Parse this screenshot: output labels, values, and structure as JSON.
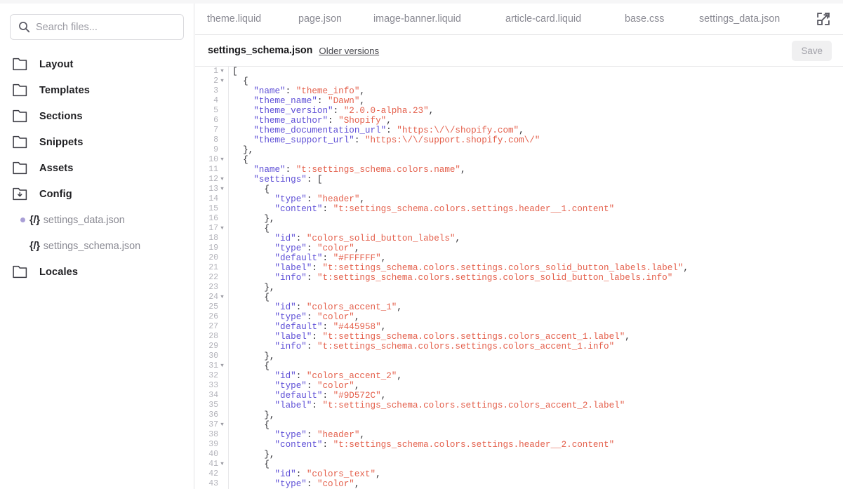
{
  "sidebar": {
    "search": {
      "placeholder": "Search files...",
      "value": "",
      "icon": "search-icon"
    },
    "items": [
      {
        "label": "Layout",
        "icon": "folder-icon",
        "type": "folder"
      },
      {
        "label": "Templates",
        "icon": "folder-icon",
        "type": "folder"
      },
      {
        "label": "Sections",
        "icon": "folder-icon",
        "type": "folder"
      },
      {
        "label": "Snippets",
        "icon": "folder-icon",
        "type": "folder"
      },
      {
        "label": "Assets",
        "icon": "folder-icon",
        "type": "folder"
      },
      {
        "label": "Config",
        "icon": "folder-open-icon",
        "type": "folder",
        "expanded": true
      },
      {
        "label": "settings_data.json",
        "icon": "json-file-icon",
        "type": "file",
        "modified": true,
        "brace": "{/}"
      },
      {
        "label": "settings_schema.json",
        "icon": "json-file-icon",
        "type": "file",
        "modified": false,
        "brace": "{/}"
      },
      {
        "label": "Locales",
        "icon": "folder-icon",
        "type": "folder"
      }
    ]
  },
  "tabs": [
    {
      "label": "theme.liquid"
    },
    {
      "label": "page.json"
    },
    {
      "label": "image-banner.liquid"
    },
    {
      "label": "article-card.liquid"
    },
    {
      "label": "base.css"
    },
    {
      "label": "settings_data.json"
    }
  ],
  "expand_icon": "expand-icon",
  "filebar": {
    "filename": "settings_schema.json",
    "older_versions_label": "Older versions",
    "save_label": "Save",
    "save_disabled": true
  },
  "colors": {
    "key": "#5d4ed6",
    "string": "#e4604c",
    "punctuation": "#2b2b30",
    "modified_dot": "#a99fd6",
    "border": "#e3e3e5",
    "save_bg": "#f0f0f1"
  },
  "editor": {
    "lines": [
      {
        "n": 1,
        "fold": true,
        "tokens": [
          [
            "p",
            "["
          ]
        ]
      },
      {
        "n": 2,
        "fold": true,
        "tokens": [
          [
            "p",
            "  {"
          ]
        ]
      },
      {
        "n": 3,
        "fold": false,
        "tokens": [
          [
            "k",
            "    \"name\""
          ],
          [
            "p",
            ": "
          ],
          [
            "s",
            "\"theme_info\""
          ],
          [
            "p",
            ","
          ]
        ]
      },
      {
        "n": 4,
        "fold": false,
        "tokens": [
          [
            "k",
            "    \"theme_name\""
          ],
          [
            "p",
            ": "
          ],
          [
            "s",
            "\"Dawn\""
          ],
          [
            "p",
            ","
          ]
        ]
      },
      {
        "n": 5,
        "fold": false,
        "tokens": [
          [
            "k",
            "    \"theme_version\""
          ],
          [
            "p",
            ": "
          ],
          [
            "s",
            "\"2.0.0-alpha.23\""
          ],
          [
            "p",
            ","
          ]
        ]
      },
      {
        "n": 6,
        "fold": false,
        "tokens": [
          [
            "k",
            "    \"theme_author\""
          ],
          [
            "p",
            ": "
          ],
          [
            "s",
            "\"Shopify\""
          ],
          [
            "p",
            ","
          ]
        ]
      },
      {
        "n": 7,
        "fold": false,
        "tokens": [
          [
            "k",
            "    \"theme_documentation_url\""
          ],
          [
            "p",
            ": "
          ],
          [
            "s",
            "\"https:\\/\\/shopify.com\""
          ],
          [
            "p",
            ","
          ]
        ]
      },
      {
        "n": 8,
        "fold": false,
        "tokens": [
          [
            "k",
            "    \"theme_support_url\""
          ],
          [
            "p",
            ": "
          ],
          [
            "s",
            "\"https:\\/\\/support.shopify.com\\/\""
          ]
        ]
      },
      {
        "n": 9,
        "fold": false,
        "tokens": [
          [
            "p",
            "  },"
          ]
        ]
      },
      {
        "n": 10,
        "fold": true,
        "tokens": [
          [
            "p",
            "  {"
          ]
        ]
      },
      {
        "n": 11,
        "fold": false,
        "tokens": [
          [
            "k",
            "    \"name\""
          ],
          [
            "p",
            ": "
          ],
          [
            "s",
            "\"t:settings_schema.colors.name\""
          ],
          [
            "p",
            ","
          ]
        ]
      },
      {
        "n": 12,
        "fold": true,
        "tokens": [
          [
            "k",
            "    \"settings\""
          ],
          [
            "p",
            ": ["
          ]
        ]
      },
      {
        "n": 13,
        "fold": true,
        "tokens": [
          [
            "p",
            "      {"
          ]
        ]
      },
      {
        "n": 14,
        "fold": false,
        "tokens": [
          [
            "k",
            "        \"type\""
          ],
          [
            "p",
            ": "
          ],
          [
            "s",
            "\"header\""
          ],
          [
            "p",
            ","
          ]
        ]
      },
      {
        "n": 15,
        "fold": false,
        "tokens": [
          [
            "k",
            "        \"content\""
          ],
          [
            "p",
            ": "
          ],
          [
            "s",
            "\"t:settings_schema.colors.settings.header__1.content\""
          ]
        ]
      },
      {
        "n": 16,
        "fold": false,
        "tokens": [
          [
            "p",
            "      },"
          ]
        ]
      },
      {
        "n": 17,
        "fold": true,
        "tokens": [
          [
            "p",
            "      {"
          ]
        ]
      },
      {
        "n": 18,
        "fold": false,
        "tokens": [
          [
            "k",
            "        \"id\""
          ],
          [
            "p",
            ": "
          ],
          [
            "s",
            "\"colors_solid_button_labels\""
          ],
          [
            "p",
            ","
          ]
        ]
      },
      {
        "n": 19,
        "fold": false,
        "tokens": [
          [
            "k",
            "        \"type\""
          ],
          [
            "p",
            ": "
          ],
          [
            "s",
            "\"color\""
          ],
          [
            "p",
            ","
          ]
        ]
      },
      {
        "n": 20,
        "fold": false,
        "tokens": [
          [
            "k",
            "        \"default\""
          ],
          [
            "p",
            ": "
          ],
          [
            "s",
            "\"#FFFFFF\""
          ],
          [
            "p",
            ","
          ]
        ]
      },
      {
        "n": 21,
        "fold": false,
        "tokens": [
          [
            "k",
            "        \"label\""
          ],
          [
            "p",
            ": "
          ],
          [
            "s",
            "\"t:settings_schema.colors.settings.colors_solid_button_labels.label\""
          ],
          [
            "p",
            ","
          ]
        ]
      },
      {
        "n": 22,
        "fold": false,
        "tokens": [
          [
            "k",
            "        \"info\""
          ],
          [
            "p",
            ": "
          ],
          [
            "s",
            "\"t:settings_schema.colors.settings.colors_solid_button_labels.info\""
          ]
        ]
      },
      {
        "n": 23,
        "fold": false,
        "tokens": [
          [
            "p",
            "      },"
          ]
        ]
      },
      {
        "n": 24,
        "fold": true,
        "tokens": [
          [
            "p",
            "      {"
          ]
        ]
      },
      {
        "n": 25,
        "fold": false,
        "tokens": [
          [
            "k",
            "        \"id\""
          ],
          [
            "p",
            ": "
          ],
          [
            "s",
            "\"colors_accent_1\""
          ],
          [
            "p",
            ","
          ]
        ]
      },
      {
        "n": 26,
        "fold": false,
        "tokens": [
          [
            "k",
            "        \"type\""
          ],
          [
            "p",
            ": "
          ],
          [
            "s",
            "\"color\""
          ],
          [
            "p",
            ","
          ]
        ]
      },
      {
        "n": 27,
        "fold": false,
        "tokens": [
          [
            "k",
            "        \"default\""
          ],
          [
            "p",
            ": "
          ],
          [
            "s",
            "\"#445958\""
          ],
          [
            "p",
            ","
          ]
        ]
      },
      {
        "n": 28,
        "fold": false,
        "tokens": [
          [
            "k",
            "        \"label\""
          ],
          [
            "p",
            ": "
          ],
          [
            "s",
            "\"t:settings_schema.colors.settings.colors_accent_1.label\""
          ],
          [
            "p",
            ","
          ]
        ]
      },
      {
        "n": 29,
        "fold": false,
        "tokens": [
          [
            "k",
            "        \"info\""
          ],
          [
            "p",
            ": "
          ],
          [
            "s",
            "\"t:settings_schema.colors.settings.colors_accent_1.info\""
          ]
        ]
      },
      {
        "n": 30,
        "fold": false,
        "tokens": [
          [
            "p",
            "      },"
          ]
        ]
      },
      {
        "n": 31,
        "fold": true,
        "tokens": [
          [
            "p",
            "      {"
          ]
        ]
      },
      {
        "n": 32,
        "fold": false,
        "tokens": [
          [
            "k",
            "        \"id\""
          ],
          [
            "p",
            ": "
          ],
          [
            "s",
            "\"colors_accent_2\""
          ],
          [
            "p",
            ","
          ]
        ]
      },
      {
        "n": 33,
        "fold": false,
        "tokens": [
          [
            "k",
            "        \"type\""
          ],
          [
            "p",
            ": "
          ],
          [
            "s",
            "\"color\""
          ],
          [
            "p",
            ","
          ]
        ]
      },
      {
        "n": 34,
        "fold": false,
        "tokens": [
          [
            "k",
            "        \"default\""
          ],
          [
            "p",
            ": "
          ],
          [
            "s",
            "\"#9D572C\""
          ],
          [
            "p",
            ","
          ]
        ]
      },
      {
        "n": 35,
        "fold": false,
        "tokens": [
          [
            "k",
            "        \"label\""
          ],
          [
            "p",
            ": "
          ],
          [
            "s",
            "\"t:settings_schema.colors.settings.colors_accent_2.label\""
          ]
        ]
      },
      {
        "n": 36,
        "fold": false,
        "tokens": [
          [
            "p",
            "      },"
          ]
        ]
      },
      {
        "n": 37,
        "fold": true,
        "tokens": [
          [
            "p",
            "      {"
          ]
        ]
      },
      {
        "n": 38,
        "fold": false,
        "tokens": [
          [
            "k",
            "        \"type\""
          ],
          [
            "p",
            ": "
          ],
          [
            "s",
            "\"header\""
          ],
          [
            "p",
            ","
          ]
        ]
      },
      {
        "n": 39,
        "fold": false,
        "tokens": [
          [
            "k",
            "        \"content\""
          ],
          [
            "p",
            ": "
          ],
          [
            "s",
            "\"t:settings_schema.colors.settings.header__2.content\""
          ]
        ]
      },
      {
        "n": 40,
        "fold": false,
        "tokens": [
          [
            "p",
            "      },"
          ]
        ]
      },
      {
        "n": 41,
        "fold": true,
        "tokens": [
          [
            "p",
            "      {"
          ]
        ]
      },
      {
        "n": 42,
        "fold": false,
        "tokens": [
          [
            "k",
            "        \"id\""
          ],
          [
            "p",
            ": "
          ],
          [
            "s",
            "\"colors_text\""
          ],
          [
            "p",
            ","
          ]
        ]
      },
      {
        "n": 43,
        "fold": false,
        "tokens": [
          [
            "k",
            "        \"type\""
          ],
          [
            "p",
            ": "
          ],
          [
            "s",
            "\"color\""
          ],
          [
            "p",
            ","
          ]
        ]
      }
    ]
  }
}
